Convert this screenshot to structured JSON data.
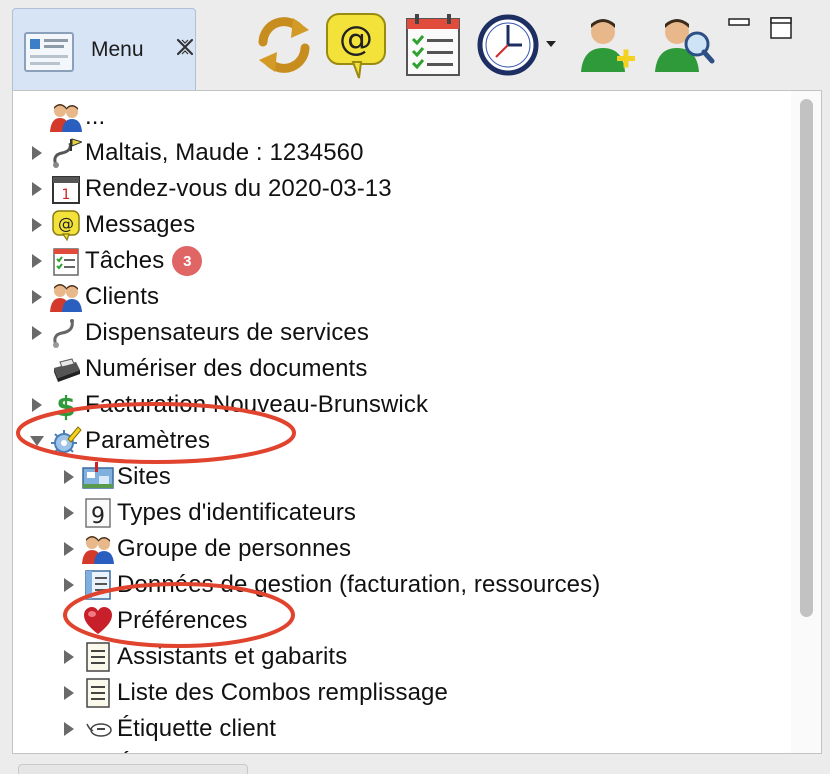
{
  "tab": {
    "label": "Menu",
    "icon": "menu-card-icon",
    "close_icon": "close-x-icon"
  },
  "toolbar": [
    {
      "name": "refresh-button",
      "icon": "sync-arrows-icon"
    },
    {
      "name": "messages-button",
      "icon": "at-speech-bubble-icon"
    },
    {
      "name": "tasks-button",
      "icon": "calendar-checklist-icon"
    },
    {
      "name": "clock-dropdown-button",
      "icon": "clock-icon"
    },
    {
      "name": "add-client-button",
      "icon": "user-add-icon"
    },
    {
      "name": "search-client-button",
      "icon": "user-search-icon"
    }
  ],
  "tree": {
    "items": [
      {
        "label": "...",
        "icon": "people-group-icon",
        "expander": "none",
        "level": 0
      },
      {
        "label": "Maltais, Maude : 1234560",
        "icon": "stethoscope-flag-icon",
        "expander": "collapsed",
        "level": 0
      },
      {
        "label": "Rendez-vous du 2020-03-13",
        "icon": "calendar-day-icon",
        "expander": "collapsed",
        "level": 0
      },
      {
        "label": "Messages",
        "icon": "at-message-icon",
        "expander": "collapsed",
        "level": 0
      },
      {
        "label": "Tâches",
        "icon": "checklist-icon",
        "expander": "collapsed",
        "level": 0,
        "badge": "3"
      },
      {
        "label": "Clients",
        "icon": "people-group-icon",
        "expander": "collapsed",
        "level": 0
      },
      {
        "label": "Dispensateurs de services",
        "icon": "stethoscope-icon",
        "expander": "collapsed",
        "level": 0
      },
      {
        "label": "Numériser des documents",
        "icon": "scanner-icon",
        "expander": "none",
        "level": 0
      },
      {
        "label": "Facturation Nouveau-Brunswick",
        "icon": "dollar-icon",
        "expander": "collapsed",
        "level": 0
      },
      {
        "label": "Paramètres",
        "icon": "settings-pencil-icon",
        "expander": "expanded",
        "level": 0
      },
      {
        "label": "Sites",
        "icon": "site-map-icon",
        "expander": "collapsed",
        "level": 1
      },
      {
        "label": "Types d'identificateurs",
        "icon": "id-number-icon",
        "expander": "collapsed",
        "level": 1
      },
      {
        "label": "Groupe de personnes",
        "icon": "people-group-icon",
        "expander": "collapsed",
        "level": 1
      },
      {
        "label": "Données de gestion (facturation, ressources)",
        "icon": "data-document-icon",
        "expander": "collapsed",
        "level": 1
      },
      {
        "label": "Préférences",
        "icon": "heart-icon",
        "expander": "none",
        "level": 1
      },
      {
        "label": "Assistants et gabarits",
        "icon": "document-lines-icon",
        "expander": "collapsed",
        "level": 1
      },
      {
        "label": "Liste des Combos remplissage",
        "icon": "document-lines-icon",
        "expander": "collapsed",
        "level": 1
      },
      {
        "label": "Étiquette client",
        "icon": "label-tag-icon",
        "expander": "collapsed",
        "level": 1
      },
      {
        "label": "Étiquettes",
        "icon": "label-tag-icon",
        "expander": "collapsed",
        "level": 1
      }
    ]
  },
  "colors": {
    "annotation": "#e0442e",
    "badge": "#e06565",
    "tab_background": "#d6e4f5"
  }
}
